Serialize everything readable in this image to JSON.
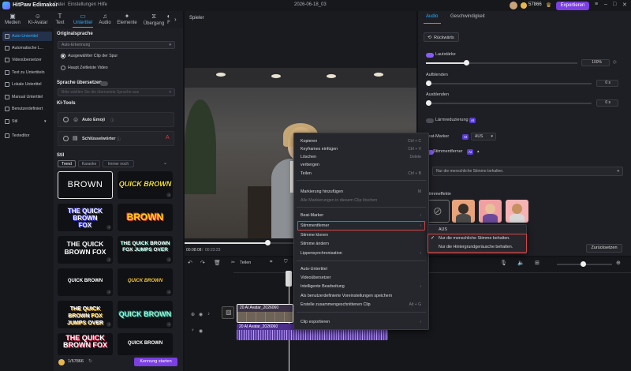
{
  "app": {
    "name": "HitPaw Edimakor",
    "menu": [
      "Datei",
      "Einstellungen",
      "Hilfe"
    ],
    "project": "2026-06-18_03",
    "credits": "57866",
    "export": "Exportieren"
  },
  "toolbar": [
    {
      "label": "Medien",
      "icon": "folder-icon"
    },
    {
      "label": "KI-Avatar",
      "icon": "avatar-icon"
    },
    {
      "label": "Text",
      "icon": "text-icon"
    },
    {
      "label": "Untertitel",
      "icon": "subtitle-icon",
      "active": true
    },
    {
      "label": "Audio",
      "icon": "audio-icon"
    },
    {
      "label": "Elemente",
      "icon": "elements-icon"
    },
    {
      "label": "Übergang",
      "icon": "transition-icon"
    },
    {
      "label": "F",
      "icon": "filter-icon"
    }
  ],
  "leftnav": [
    {
      "label": "Auto-Untertitel",
      "active": true
    },
    {
      "label": "Automatische L..."
    },
    {
      "label": "Videoübersetzer"
    },
    {
      "label": "Text zu Untertiteln"
    },
    {
      "label": "Lokale Untertitel"
    },
    {
      "label": "Manual Untertitel"
    },
    {
      "label": "Benutzerdefiniert"
    },
    {
      "label": "Stil"
    },
    {
      "label": "Texteditor"
    }
  ],
  "subtitle": {
    "source_title": "Originalsprache",
    "source_value": "Auto-Erkennung",
    "radio1": "Ausgewählter Clip der Spur",
    "radio2": "Haupt Zeitleiste Video",
    "translate_title": "Sprache übersetzen",
    "translate_placeholder": "Bitte wählen Sie die übersetzte Sprache aus",
    "ai_tools_title": "KI-Tools",
    "auto_emoji": "Auto Emoji",
    "keywords": "Schlüsselwörter",
    "style_title": "Stil",
    "style_tabs": [
      "Trend",
      "Karaoke",
      "Immer noch"
    ],
    "start_button": "Kennung starten",
    "credits": "1/57866"
  },
  "style_tiles": [
    "BROWN",
    "QUICK BROWN",
    "THE QUICK BROWN FOX",
    "BROWN",
    "THE QUICK BROWN FOX",
    "THE QUICK BROWN FOX JUMPS OVER",
    "QUICK BROWN",
    "QUICK BROWN",
    "THE QUICK BROWN FOX JUMPS OVER",
    "QUICK BROWN",
    "THE QUICK BROWN FOX",
    "QUICK BROWN"
  ],
  "player": {
    "title": "Spieler",
    "current": "00:08:08",
    "total": "00:23:23"
  },
  "right": {
    "tabs": [
      "Audio",
      "Geschwindigkeit"
    ],
    "back": "Rückwärts",
    "volume": "Lautstärke",
    "volume_value": "100%",
    "fade_in": "Aufblenden",
    "fade_in_value": "0 s",
    "fade_out": "Ausblenden",
    "fade_out_value": "0 s",
    "noise": "Lärmreduzierung",
    "ai": "AI",
    "beat": "Beat-Marker",
    "beat_value": "AUS",
    "voice_remover": "Stimmentferner",
    "voice_select": "Nur die menschliche Stimme behalten.",
    "effects": "Stimmeffekte",
    "reset": "Zurücksetzen"
  },
  "ctx": {
    "items": [
      {
        "label": "Kopieren",
        "sc": "Ctrl + C"
      },
      {
        "label": "Keyframes einfügen",
        "sc": "Ctrl + V"
      },
      {
        "label": "Löschen",
        "sc": "Delete"
      },
      {
        "label": "verbergen",
        "sc": ""
      },
      {
        "label": "Teilen",
        "sc": "Ctrl + B"
      },
      {
        "label": "Markierung hinzufügen",
        "sc": "M"
      },
      {
        "label": "Alle Markierungen in diesem Clip löschen",
        "sc": "",
        "dis": true
      },
      {
        "label": "Beat-Marker",
        "sc": "›"
      },
      {
        "label": "Stimmentferner",
        "sc": "›"
      },
      {
        "label": "Stimme klonen",
        "sc": ""
      },
      {
        "label": "Stimme ändern",
        "sc": ""
      },
      {
        "label": "Lippensynchronisation",
        "sc": "›"
      },
      {
        "label": "Auto-Untertitel",
        "sc": ""
      },
      {
        "label": "Videoübersetzer",
        "sc": ""
      },
      {
        "label": "Intelligente Bearbeitung",
        "sc": "›"
      },
      {
        "label": "Als benutzerdefinierte Voreinstellungen speichern",
        "sc": ""
      },
      {
        "label": "Erstelle zusammengeschnittenen Clip",
        "sc": "Alt + G"
      },
      {
        "label": "Clip exportieren",
        "sc": "›"
      }
    ]
  },
  "submenu": {
    "items": [
      "AUS",
      "Nur die menschliche Stimme behalten.",
      "Nur die Hintergrundgeräusche behalten."
    ]
  },
  "timeline": {
    "split": "Teilen",
    "clip1": "20 AI Avatar_2026060",
    "clip2": "20 AI Avatar_2026060"
  }
}
